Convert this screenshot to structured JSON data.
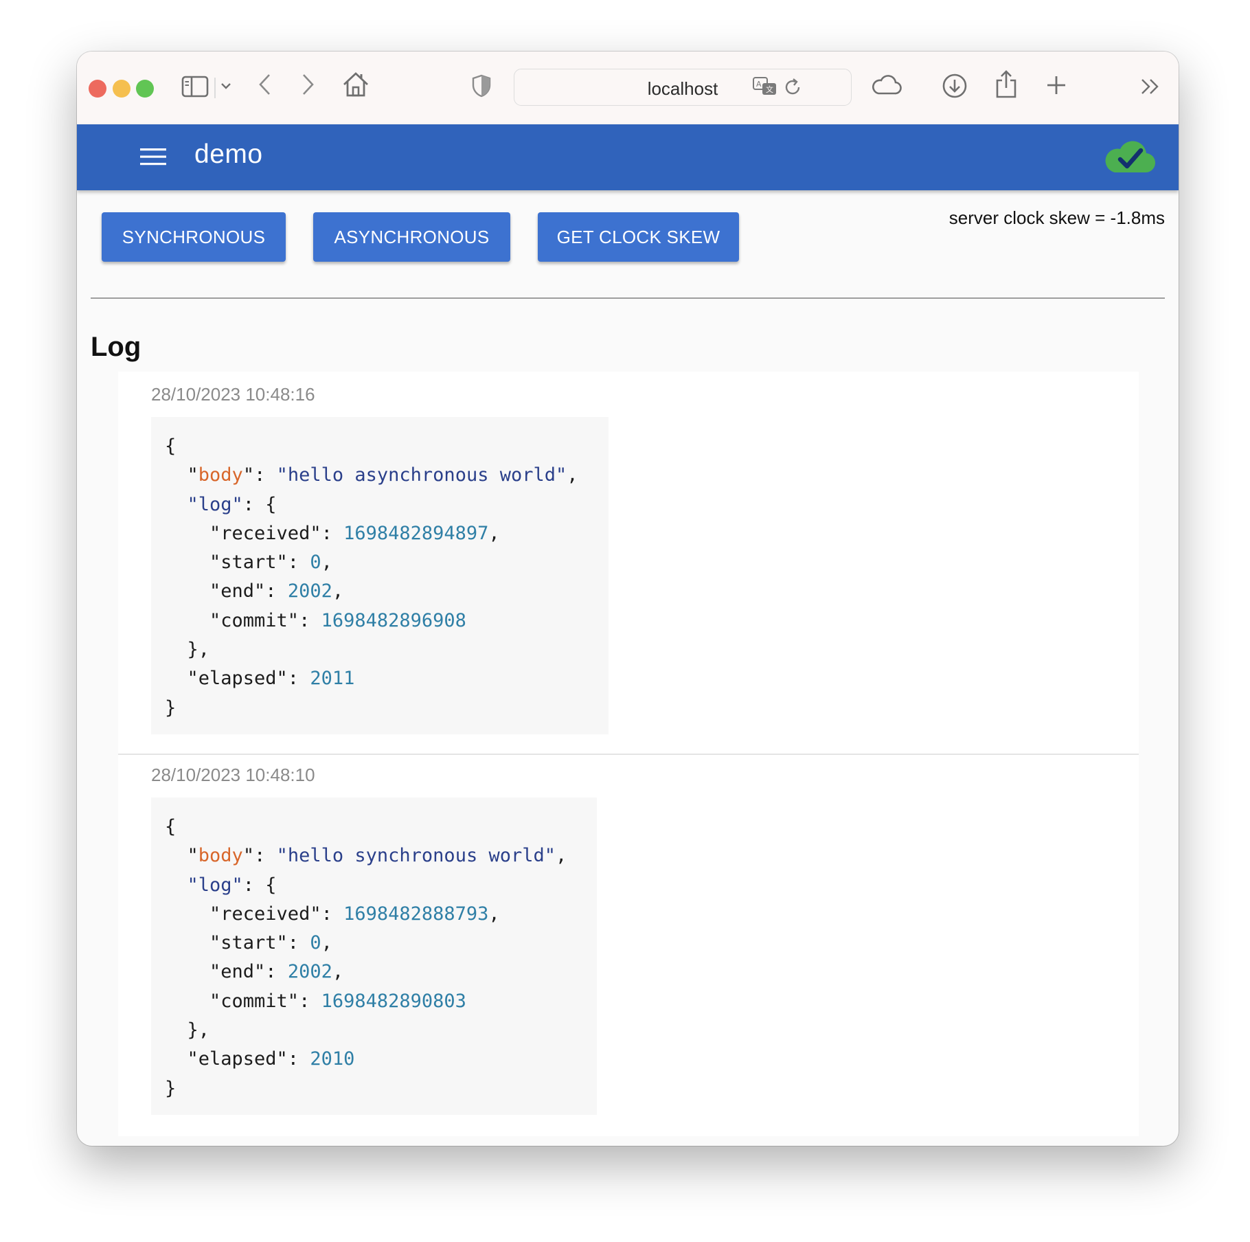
{
  "browser": {
    "url": "localhost",
    "colors": {
      "close": "#ed6a5e",
      "minimize": "#f5bf4f",
      "maximize": "#61c554"
    },
    "icons": [
      "sidebar-icon",
      "chevron-down-icon",
      "back-arrow-icon",
      "forward-arrow-icon",
      "home-icon",
      "privacy-shield-icon",
      "translate-icon",
      "reload-icon",
      "icloud-icon",
      "downloads-icon",
      "share-icon",
      "new-tab-icon",
      "more-chevrons-icon"
    ]
  },
  "app": {
    "title": "demo",
    "status_icon": "cloud-check-icon",
    "colors": {
      "appbar": "#3063bb",
      "button": "#3d72d0",
      "status": "#4caf50"
    }
  },
  "actions": {
    "synchronous": "SYNCHRONOUS",
    "asynchronous": "ASYNCHRONOUS",
    "clock_skew": "GET CLOCK SKEW"
  },
  "skew_text": "server clock skew = -1.8ms",
  "log": {
    "title": "Log",
    "entries": [
      {
        "timestamp": "28/10/2023 10:48:16",
        "body": "hello asynchronous world",
        "received": "1698482894897",
        "start": "0",
        "end": "2002",
        "commit": "1698482896908",
        "elapsed": "2011"
      },
      {
        "timestamp": "28/10/2023 10:48:10",
        "body": "hello synchronous world",
        "received": "1698482888793",
        "start": "0",
        "end": "2002",
        "commit": "1698482890803",
        "elapsed": "2010"
      }
    ]
  }
}
